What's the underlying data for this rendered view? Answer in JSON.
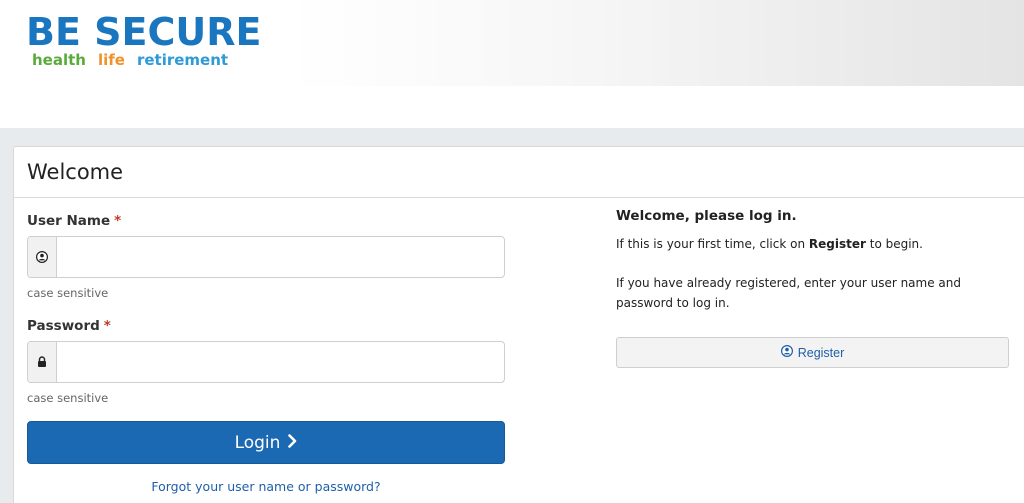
{
  "brand": {
    "name": "BE SECURE",
    "tagline": [
      "health",
      "life",
      "retirement"
    ],
    "colors": {
      "primary": "#1a76bf",
      "health": "#5aaa3c",
      "life": "#f0922a",
      "retirement": "#2f9ad8"
    }
  },
  "panel": {
    "title": "Welcome"
  },
  "form": {
    "username": {
      "label": "User Name",
      "required_mark": "*",
      "value": "",
      "help": "case sensitive",
      "icon": "user-icon"
    },
    "password": {
      "label": "Password",
      "required_mark": "*",
      "value": "",
      "help": "case sensitive",
      "icon": "lock-icon"
    },
    "login_label": "Login",
    "forgot_link": "Forgot your user name or password?",
    "button_color": "#1b69b3"
  },
  "info": {
    "heading": "Welcome, please log in.",
    "first_time_pre": "If this is your first time, click on ",
    "first_time_bold": "Register",
    "first_time_post": " to begin.",
    "registered_text": "If you have already registered, enter your user name and password to log in.",
    "register_label": "Register",
    "register_icon": "user-icon"
  }
}
